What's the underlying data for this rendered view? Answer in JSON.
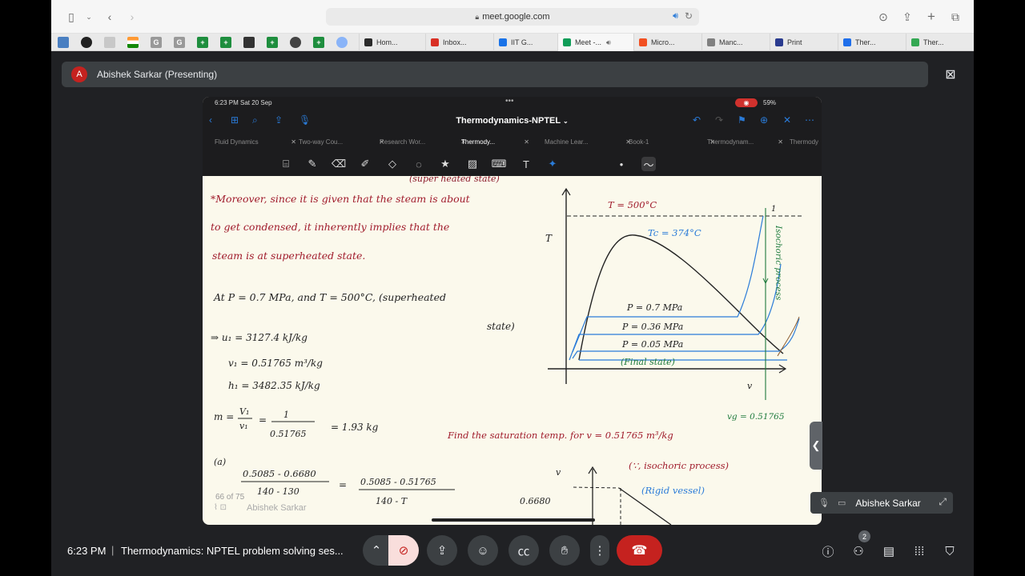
{
  "browser": {
    "url": "meet.google.com",
    "tabs": [
      {
        "label": "Hom...",
        "color": "#2b2b2b"
      },
      {
        "label": "Inbox...",
        "color": "#d93025"
      },
      {
        "label": "IIT G...",
        "color": "#1a73e8"
      },
      {
        "label": "Meet -...",
        "color": "#0f9d58"
      },
      {
        "label": "Micro...",
        "color": "#f25022"
      },
      {
        "label": "Manc...",
        "color": "#808080"
      },
      {
        "label": "Print",
        "color": "#2a3b8f"
      },
      {
        "label": "Ther...",
        "color": "#1f6feb"
      },
      {
        "label": "Ther...",
        "color": "#34a853"
      }
    ]
  },
  "meet": {
    "presenter_initial": "A",
    "presenter_label": "Abishek Sarkar (Presenting)",
    "self_name": "Abishek Sarkar",
    "time": "6:23 PM",
    "separator": "|",
    "meeting_name": "Thermodynamics: NPTEL problem solving ses...",
    "people_count": "2"
  },
  "ipad": {
    "status_time": "6:23 PM  Sat 20 Sep",
    "battery": "59%",
    "doc_title": "Thermodynamics-NPTEL",
    "doc_tabs": [
      "Fluid Dynamics",
      "Two-way Cou...",
      "Research Wor...",
      "Thermody...",
      "Machine Lear...",
      "Book-1",
      "Thermodynam...",
      "Thermody"
    ],
    "page_counter": "66 of 75",
    "ghost_name": "Abishek Sarkar"
  },
  "notes": {
    "top_cut": "(super heated state)",
    "red_lines": [
      "*Moreover, since it is given that the steam is about",
      "to get condensed, it inherently implies that the",
      "steam is at superheated state."
    ],
    "at_line": "At P = 0.7 MPa, and T = 500°C, (superheated",
    "at_line2": "state)",
    "u1": "⇒ u₁ = 3127.4 kJ/kg",
    "v1": "v₁ = 0.51765 m³/kg",
    "h1": "h₁ = 3482.35 kJ/kg",
    "m_eq": "m = V₁/v₁ = 1/0.51765 = 1.93 kg",
    "m_lhs": "m =",
    "m_frac_top": "V₁",
    "m_frac_bot": "v₁",
    "m_mid": "=",
    "m_one": "1",
    "m_den": "0.51765",
    "m_res": "= 1.93 kg",
    "a_label": "(a)",
    "a_num": "0.5085 - 0.6680",
    "a_den": "140 - 130",
    "a_eq": "=",
    "a_num2": "0.5085 - 0.51765",
    "a_den2": "140 - T",
    "find": "Find the saturation temp. for v = 0.51765 m³/kg",
    "isochoric": "(∵, isochoric process)",
    "rigid": "(Rigid vessel)",
    "v_axis": "v",
    "v_val": "0.6680",
    "diagram": {
      "t_label": "T",
      "t500": "T = 500°C",
      "tc": "Tc = 374°C",
      "pt1": "1",
      "p07": "P = 0.7 MPa",
      "p036": "P = 0.36 MPa",
      "p005": "P = 0.05 MPa",
      "final": "(Final state)",
      "iso": "Isochoric process",
      "v_axis": "v",
      "vg": "vg = 0.51765"
    }
  }
}
